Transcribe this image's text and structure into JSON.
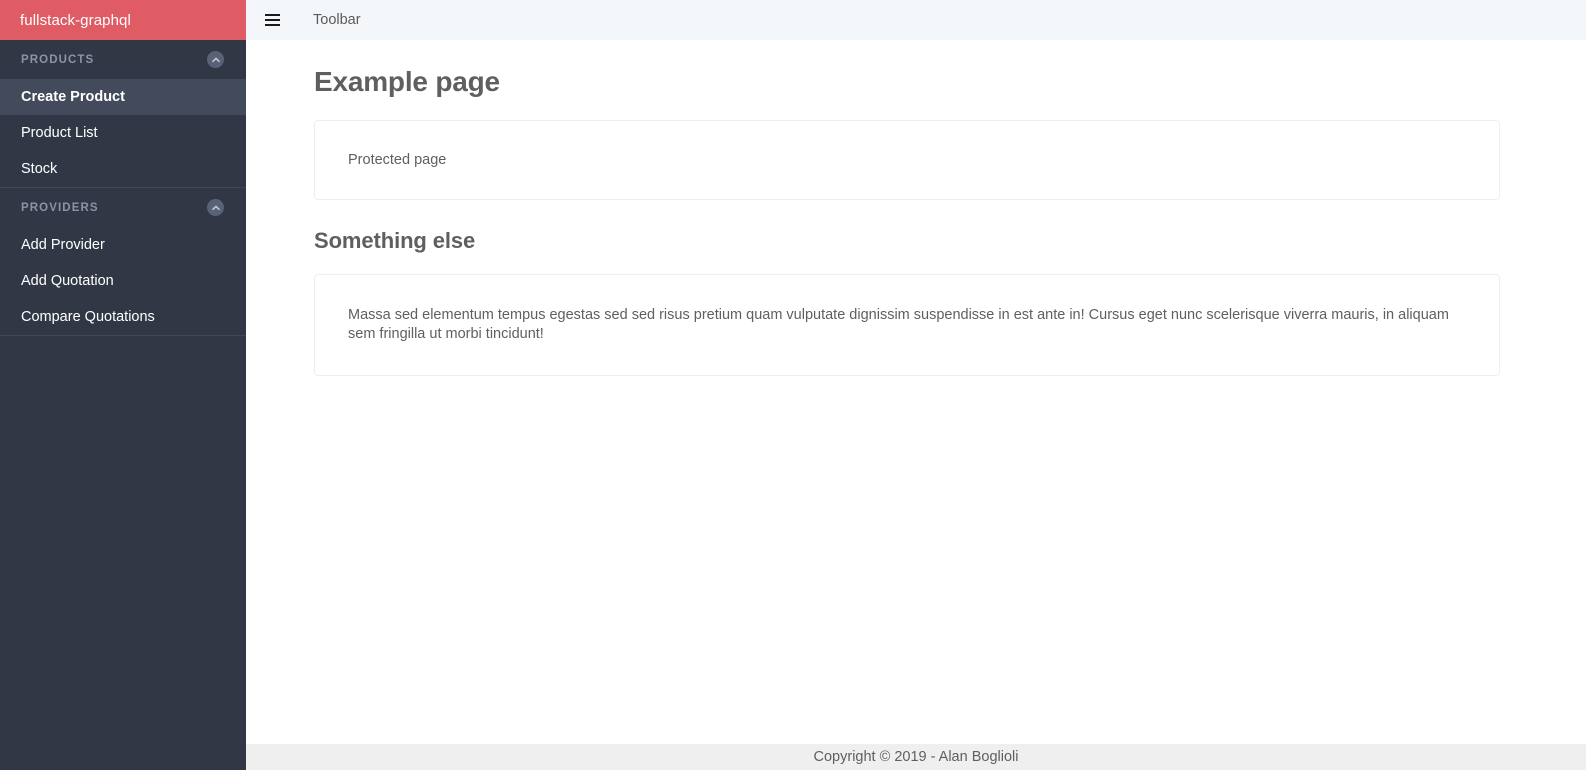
{
  "brand": {
    "title": "fullstack-graphql",
    "background_color": "#e05c64"
  },
  "sidebar": {
    "background_color": "#313745",
    "active_item_color": "#434a5c",
    "sections": [
      {
        "title": "PRODUCTS",
        "collapse_icon": "chevron-up-circle-icon",
        "items": [
          {
            "label": "Create Product",
            "active": true
          },
          {
            "label": "Product List",
            "active": false
          },
          {
            "label": "Stock",
            "active": false
          }
        ]
      },
      {
        "title": "PROVIDERS",
        "collapse_icon": "chevron-up-circle-icon",
        "items": [
          {
            "label": "Add Provider",
            "active": false
          },
          {
            "label": "Add Quotation",
            "active": false
          },
          {
            "label": "Compare Quotations",
            "active": false
          }
        ]
      }
    ]
  },
  "toolbar": {
    "menu_icon": "hamburger-menu-icon",
    "title": "Toolbar",
    "background_color": "#f4f7fa"
  },
  "main": {
    "page_title": "Example page",
    "cards": [
      {
        "text": "Protected page"
      }
    ],
    "section_heading": "Something else",
    "section_card": {
      "text": "Massa sed elementum tempus egestas sed sed risus pretium quam vulputate dignissim suspendisse in est ante in! Cursus eget nunc scelerisque viverra mauris, in aliquam sem fringilla ut morbi tincidunt!"
    }
  },
  "footer": {
    "text": "Copyright © 2019 - Alan Boglioli",
    "background_color": "#efefef"
  }
}
